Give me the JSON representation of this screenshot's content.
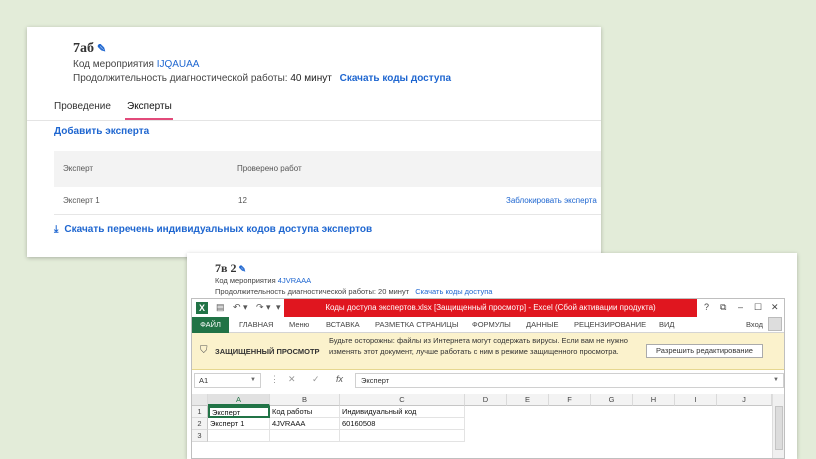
{
  "card1": {
    "title": "7аб",
    "event_code_label": "Код мероприятия",
    "event_code": "IJQAUAA",
    "duration_label": "Продолжительность диагностической работы:",
    "duration_value": "40 минут",
    "download_codes": "Скачать коды доступа",
    "tabs": [
      "Проведение",
      "Эксперты"
    ],
    "active_tab": "Эксперты",
    "add_expert": "Добавить эксперта",
    "table": {
      "headers": [
        "Эксперт",
        "Проверено работ"
      ],
      "rows": [
        {
          "expert": "Эксперт 1",
          "checked": "12",
          "action": "Заблокировать эксперта"
        }
      ]
    },
    "download_list": "Скачать перечень индивидуальных кодов доступа экспертов"
  },
  "card2": {
    "title": "7в 2",
    "event_code_label": "Код мероприятия",
    "event_code": "4JVRAAA",
    "duration_label": "Продолжительность диагностической работы:",
    "duration_value": "20 минут",
    "download_codes": "Скачать коды доступа"
  },
  "excel": {
    "window_title": "Коды доступа экспертов.xlsx  [Защищенный просмотр] -  Excel (Сбой активации продукта)",
    "window_controls": [
      "?",
      "⧉",
      "–",
      "☐",
      "✕"
    ],
    "ribbon_tabs": [
      "ФАЙЛ",
      "ГЛАВНАЯ",
      "Меню",
      "ВСТАВКА",
      "РАЗМЕТКА СТРАНИЦЫ",
      "ФОРМУЛЫ",
      "ДАННЫЕ",
      "РЕЦЕНЗИРОВАНИЕ",
      "ВИД"
    ],
    "login": "Вход",
    "protected_title": "ЗАЩИЩЕННЫЙ ПРОСМОТР",
    "protected_message": "Будьте осторожны: файлы из Интернета могут содержать вирусы. Если вам не нужно изменять этот документ, лучше работать с ним в режиме защищенного просмотра.",
    "enable_editing": "Разрешить редактирование",
    "name_box": "A1",
    "formula_value": "Эксперт",
    "columns": [
      "A",
      "B",
      "C",
      "D",
      "E",
      "F",
      "G",
      "H",
      "I",
      "J"
    ],
    "rows": [
      [
        "Эксперт",
        "Код работы",
        "Индивидуальный код"
      ],
      [
        "Эксперт 1",
        "4JVRAAA",
        "60160508"
      ],
      [
        "",
        "",
        ""
      ]
    ],
    "row_numbers": [
      "1",
      "2",
      "3"
    ],
    "colors": {
      "excel_green": "#217346",
      "title_red": "#e0161f",
      "link_blue": "#1e66d0",
      "tab_accent": "#e24a7a"
    }
  }
}
